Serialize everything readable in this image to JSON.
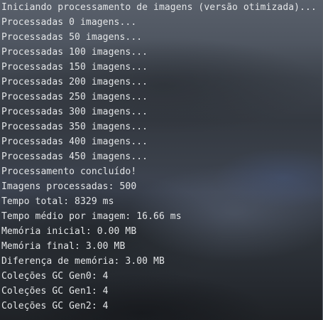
{
  "terminal": {
    "lines": [
      "Iniciando processamento de imagens (versão otimizada)...",
      "Processadas 0 imagens...",
      "Processadas 50 imagens...",
      "Processadas 100 imagens...",
      "Processadas 150 imagens...",
      "Processadas 200 imagens...",
      "Processadas 250 imagens...",
      "Processadas 300 imagens...",
      "Processadas 350 imagens...",
      "Processadas 400 imagens...",
      "Processadas 450 imagens...",
      "Processamento concluído!",
      "Imagens processadas: 500",
      "Tempo total: 8329 ms",
      "Tempo médio por imagem: 16.66 ms",
      "Memória inicial: 0.00 MB",
      "Memória final: 3.00 MB",
      "Diferença de memória: 3.00 MB",
      "Coleções GC Gen0: 4",
      "Coleções GC Gen1: 4",
      "Coleções GC Gen2: 4"
    ]
  },
  "colors": {
    "text": "#e4e6e8"
  }
}
